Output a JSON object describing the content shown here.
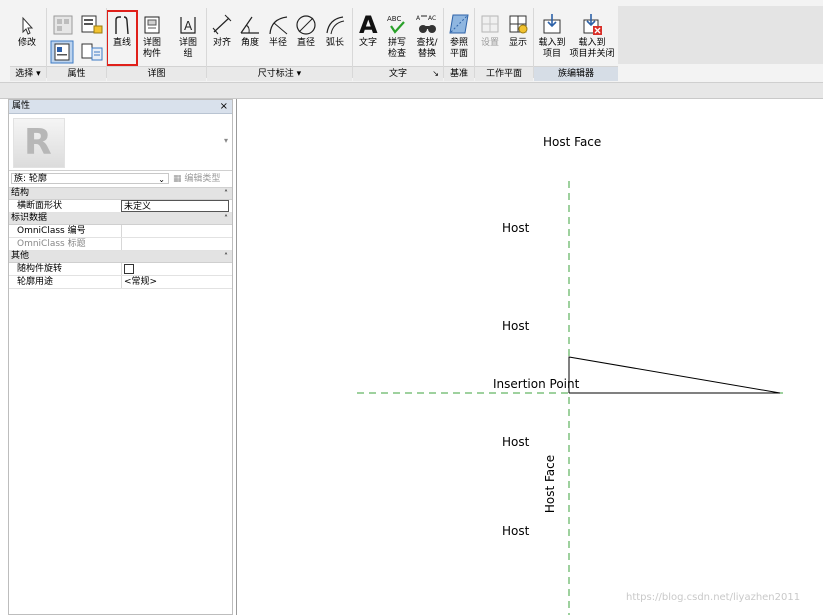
{
  "ribbon": {
    "tools": {
      "modify": "修改",
      "line": "直线",
      "detail_component_l1": "详图",
      "detail_component_l2": "构件",
      "detail_group_l1": "详图",
      "detail_group_l2": "组",
      "align": "对齐",
      "angle": "角度",
      "radius": "半径",
      "diameter": "直径",
      "arc_length": "弧长",
      "text": "文字",
      "spelling_l1": "拼写",
      "spelling_l2": "检查",
      "find_l1": "查找/",
      "find_l2": "替换",
      "ref_plane_l1": "参照",
      "ref_plane_l2": "平面",
      "set": "设置",
      "show": "显示",
      "load_project_l1": "载入到",
      "load_project_l2": "项目",
      "load_close_l1": "载入到",
      "load_close_l2": "项目并关闭"
    },
    "groups": {
      "select": "选择 ▾",
      "properties": "属性",
      "detail": "详图",
      "dimension": "尺寸标注 ▾",
      "text": "文字",
      "text_arrow": "↘",
      "datum": "基准",
      "work_plane": "工作平面",
      "family_editor": "族编辑器"
    }
  },
  "properties_panel": {
    "title": "属性",
    "close": "×",
    "family": "族: 轮廓",
    "edit_type": "编辑类型",
    "sections": {
      "structure": "结构",
      "identity": "标识数据",
      "other": "其他"
    },
    "rows": {
      "profile_usage_label": "横断面形状",
      "profile_usage_value": "未定义",
      "omniclass_number": "OmniClass 编号",
      "omniclass_title": "OmniClass 标题",
      "rotate_with_component": "随构件旋转",
      "profile_use_label": "轮廓用途",
      "profile_use_value": "<常规>"
    }
  },
  "drawing": {
    "labels": {
      "host_face_top": "Host Face",
      "host1": "Host",
      "host2": "Host",
      "insertion_point": "Insertion Point",
      "host3": "Host",
      "host_face_vertical": "Host Face",
      "host4": "Host"
    },
    "colors": {
      "ref_line": "#3da33d",
      "profile": "#000000"
    }
  },
  "watermark": "https://blog.csdn.net/liyazhen2011"
}
